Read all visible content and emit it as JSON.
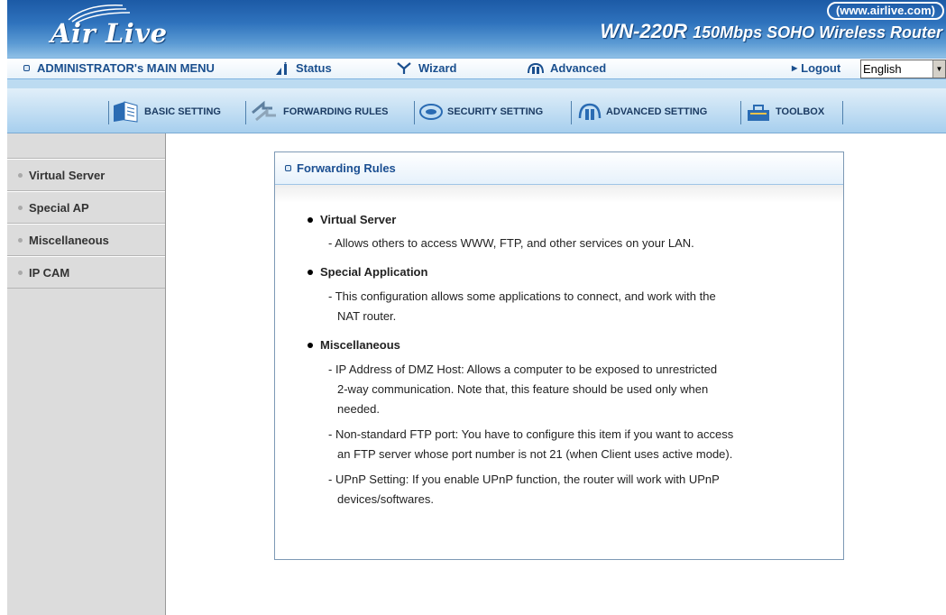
{
  "header": {
    "brand": "Air Live",
    "url": "(www.airlive.com)",
    "model": "WN-220R",
    "description": "150Mbps SOHO Wireless Router"
  },
  "menu": {
    "main_menu": "ADMINISTRATOR's MAIN MENU",
    "status": "Status",
    "wizard": "Wizard",
    "advanced": "Advanced",
    "logout": "Logout",
    "language": "English"
  },
  "tabs": [
    {
      "label": "BASIC SETTING",
      "icon": "book-icon"
    },
    {
      "label": "FORWARDING RULES",
      "icon": "forward-arrows-icon"
    },
    {
      "label": "SECURITY SETTING",
      "icon": "shield-icon"
    },
    {
      "label": "ADVANCED SETTING",
      "icon": "gear-icon"
    },
    {
      "label": "TOOLBOX",
      "icon": "toolbox-icon"
    }
  ],
  "sidebar": {
    "items": [
      {
        "label": "Virtual Server"
      },
      {
        "label": "Special AP"
      },
      {
        "label": "Miscellaneous"
      },
      {
        "label": "IP CAM"
      }
    ]
  },
  "content": {
    "title": "Forwarding Rules",
    "sections": [
      {
        "title": "Virtual Server",
        "lines": [
          "- Allows others to access WWW, FTP, and other services on your LAN."
        ]
      },
      {
        "title": "Special Application",
        "lines": [
          "- This configuration allows some applications to connect, and work with the",
          "NAT router."
        ]
      },
      {
        "title": "Miscellaneous",
        "lines": [
          "- IP Address of DMZ Host: Allows a computer to be exposed to unrestricted",
          "2-way communication. Note that, this feature should be used only when",
          "needed.",
          "- Non-standard FTP port: You have to configure this item if you want to access",
          "an FTP server whose port number is not 21 (when Client uses active mode).",
          "- UPnP Setting: If you enable UPnP function, the router will work with UPnP",
          "devices/softwares."
        ]
      }
    ]
  },
  "colors": {
    "header_blue": "#2f73bd",
    "menu_text": "#1a4f8e",
    "tab_bg": "#a7cfee",
    "sidebar_bg": "#dcdcdc"
  }
}
